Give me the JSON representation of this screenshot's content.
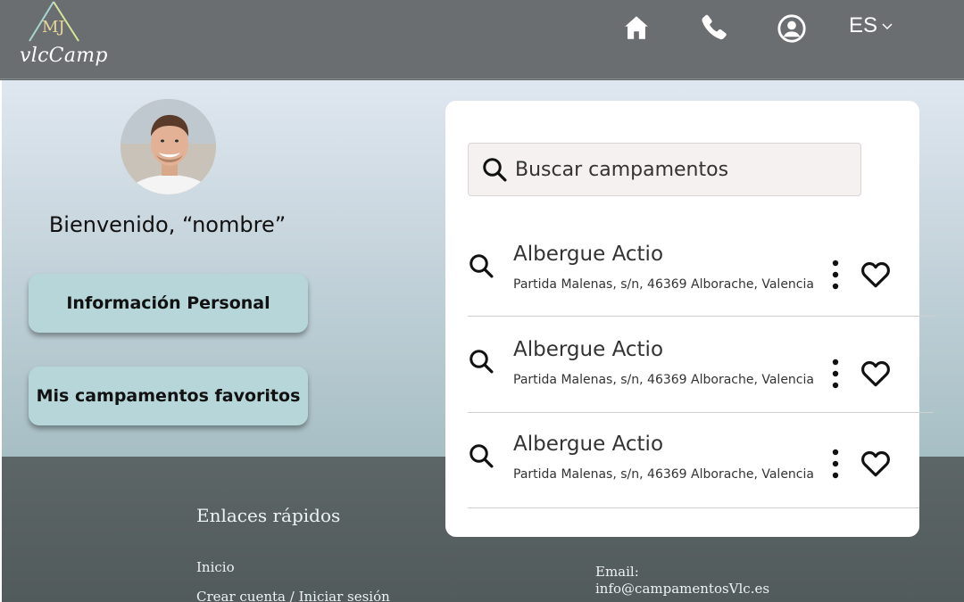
{
  "header": {
    "logo_monogram": "MJ",
    "logo_text": "vlcCamp",
    "nav": [
      {
        "icon": "home-icon"
      },
      {
        "icon": "phone-icon"
      },
      {
        "icon": "user-circle-icon"
      }
    ],
    "language": "ES"
  },
  "profile": {
    "welcome": "Bienvenido, “nombre”",
    "buttons": {
      "personal_info": "Información Personal",
      "favorites": "Mis campamentos favoritos"
    }
  },
  "search": {
    "placeholder": "Buscar campamentos",
    "results": [
      {
        "name": "Albergue Actio",
        "address": "Partida Malenas, s/n, 46369 Alborache, Valencia"
      },
      {
        "name": "Albergue Actio",
        "address": "Partida Malenas, s/n, 46369 Alborache, Valencia"
      },
      {
        "name": "Albergue Actio",
        "address": "Partida Malenas, s/n, 46369 Alborache, Valencia"
      }
    ]
  },
  "footer": {
    "quick_links_title": "Enlaces rápidos",
    "links": [
      "Inicio",
      "Crear cuenta / Iniciar sesión"
    ],
    "email_label": "Email:",
    "email": "info@campamentosVlc.es"
  },
  "colors": {
    "header_bg": "#6b6e71",
    "button_bg": "#b6d6d9",
    "footer_bg": "#5b6466"
  }
}
